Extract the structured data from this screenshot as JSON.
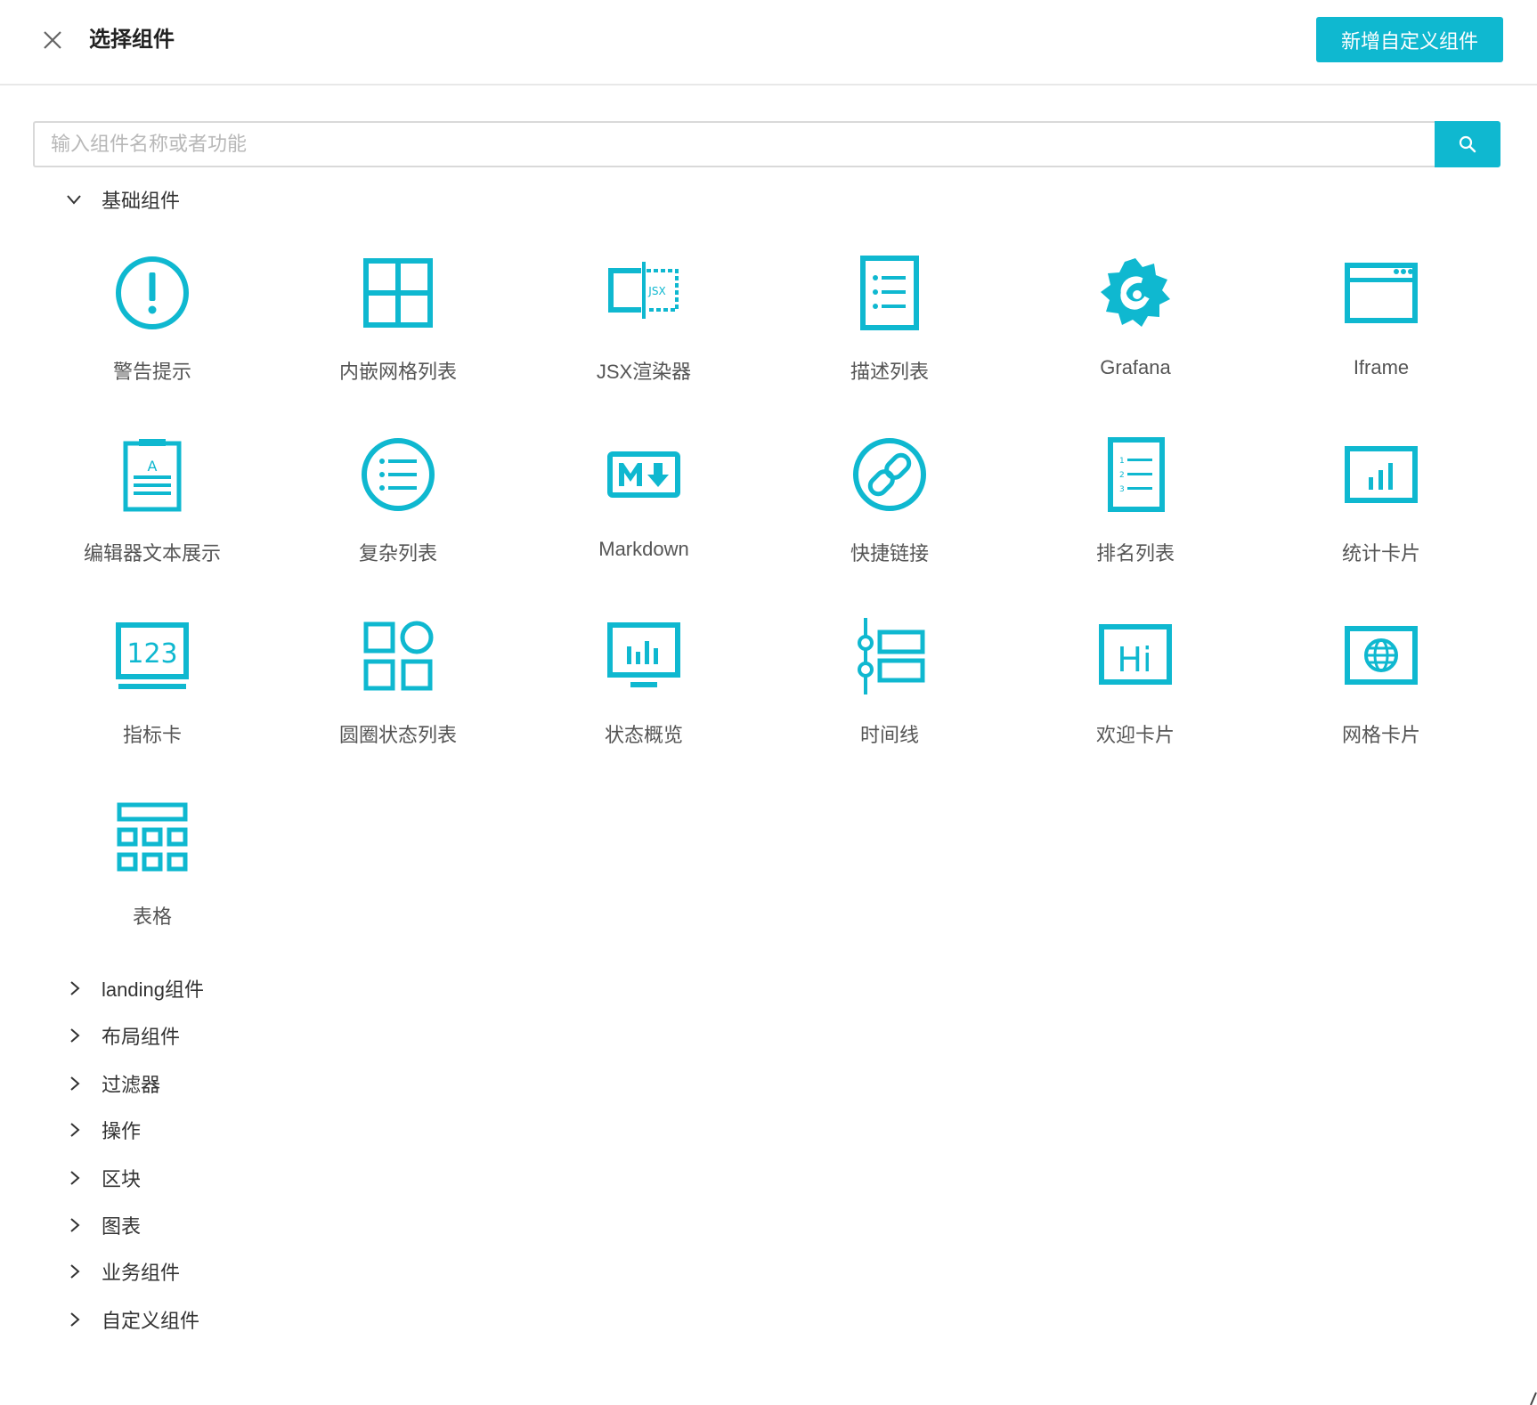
{
  "header": {
    "title": "选择组件",
    "add_button_label": "新增自定义组件"
  },
  "search": {
    "placeholder": "输入组件名称或者功能"
  },
  "colors": {
    "accent": "#0fb8d0"
  },
  "expanded_group": {
    "label": "基础组件",
    "items": [
      {
        "label": "警告提示",
        "icon": "alert-icon"
      },
      {
        "label": "内嵌网格列表",
        "icon": "grid-list-icon"
      },
      {
        "label": "JSX渲染器",
        "icon": "jsx-icon"
      },
      {
        "label": "描述列表",
        "icon": "description-list-icon"
      },
      {
        "label": "Grafana",
        "icon": "grafana-icon"
      },
      {
        "label": "Iframe",
        "icon": "iframe-icon"
      },
      {
        "label": "编辑器文本展示",
        "icon": "editor-text-icon"
      },
      {
        "label": "复杂列表",
        "icon": "complex-list-icon"
      },
      {
        "label": "Markdown",
        "icon": "markdown-icon"
      },
      {
        "label": "快捷链接",
        "icon": "link-icon"
      },
      {
        "label": "排名列表",
        "icon": "ranking-list-icon"
      },
      {
        "label": "统计卡片",
        "icon": "stats-card-icon"
      },
      {
        "label": "指标卡",
        "icon": "metric-card-icon"
      },
      {
        "label": "圆圈状态列表",
        "icon": "circle-status-icon"
      },
      {
        "label": "状态概览",
        "icon": "status-overview-icon"
      },
      {
        "label": "时间线",
        "icon": "timeline-icon"
      },
      {
        "label": "欢迎卡片",
        "icon": "welcome-card-icon"
      },
      {
        "label": "网格卡片",
        "icon": "grid-card-icon"
      },
      {
        "label": "表格",
        "icon": "table-icon"
      }
    ]
  },
  "collapsed_groups": [
    {
      "label": "landing组件"
    },
    {
      "label": "布局组件"
    },
    {
      "label": "过滤器"
    },
    {
      "label": "操作"
    },
    {
      "label": "区块"
    },
    {
      "label": "图表"
    },
    {
      "label": "业务组件"
    },
    {
      "label": "自定义组件"
    }
  ]
}
